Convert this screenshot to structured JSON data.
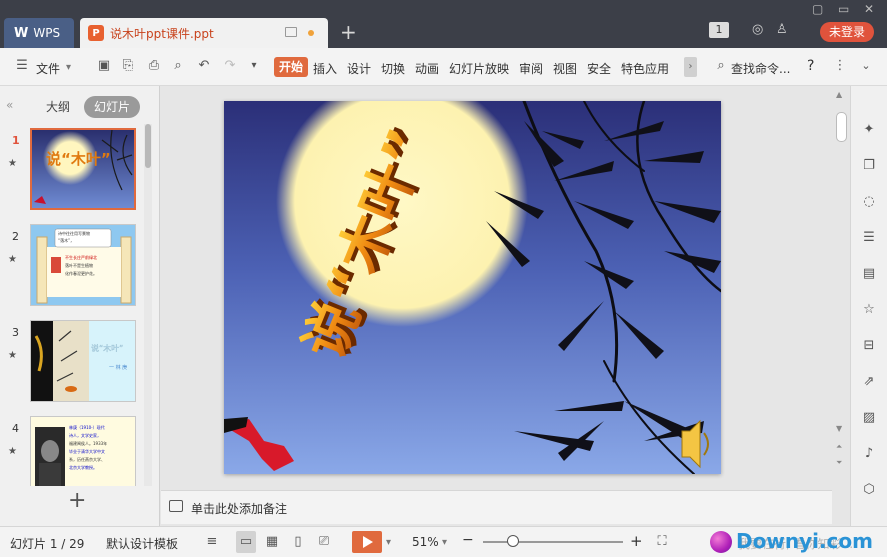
{
  "app": {
    "brand": "WPS",
    "doc_tab": "说木叶ppt课件.ppt",
    "new_tab_symbol": "+",
    "badge": "1",
    "login_label": "未登录"
  },
  "ribbon": {
    "file_label": "文件",
    "tabs": [
      "开始",
      "插入",
      "设计",
      "切换",
      "动画",
      "幻灯片放映",
      "审阅",
      "视图",
      "安全",
      "特色应用"
    ],
    "search_label": "查找命令...",
    "help_symbol": "?"
  },
  "left_pane": {
    "tab_outline": "大纲",
    "tab_slides": "幻灯片",
    "slide_numbers": [
      "1",
      "2",
      "3",
      "4"
    ]
  },
  "slide": {
    "title_text": "说“木叶”"
  },
  "thumbs": {
    "t1_title": "说“木叶”",
    "t3_title": "说“木叶”",
    "t3_sub": "一 林 庚",
    "t2_lines": [
      "诗中往往用写景物",
      "“落木”，",
      "不生长庄严前绿北",
      "落叶不是生植物",
      "化作春泥更护花。"
    ],
    "t4_lines": [
      "林庚（1910-）现代",
      "诗人，文学史家，",
      "福建闽侯人。1933年",
      "毕业于清华大学中文",
      "系，历任燕京大学、",
      "北京大学教授。"
    ]
  },
  "notes": {
    "placeholder": "单击此处添加备注"
  },
  "status": {
    "slide_counter": "幻灯片 1 / 29",
    "template_label": "默认设计模板",
    "zoom_value": "51%",
    "watermark_brand": "Downyi.com",
    "watermark_sub": "我要在行, 看你知彩..."
  },
  "colors": {
    "titlebar": "#3c3f48",
    "accent": "#e06a3e",
    "login": "#e0533c"
  }
}
